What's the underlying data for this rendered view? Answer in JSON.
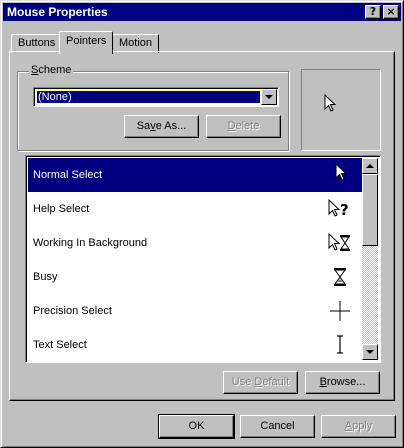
{
  "window": {
    "title": "Mouse Properties",
    "help_glyph": "?",
    "close_glyph": "×"
  },
  "tabs": [
    {
      "label": "Buttons",
      "active": false
    },
    {
      "label": "Pointers",
      "active": true
    },
    {
      "label": "Motion",
      "active": false
    }
  ],
  "scheme": {
    "group_label_first": "S",
    "group_label_rest": "cheme",
    "selected_value": "(None)",
    "save_as_label_pre": "Sa",
    "save_as_label_mn": "v",
    "save_as_label_post": "e As...",
    "delete_label_pre": "",
    "delete_label_mn": "D",
    "delete_label_post": "elete"
  },
  "pointers": [
    {
      "label": "Normal Select",
      "icon": "arrow-cursor-icon",
      "selected": true
    },
    {
      "label": "Help Select",
      "icon": "help-cursor-icon",
      "selected": false
    },
    {
      "label": "Working In Background",
      "icon": "working-cursor-icon",
      "selected": false
    },
    {
      "label": "Busy",
      "icon": "hourglass-icon",
      "selected": false
    },
    {
      "label": "Precision Select",
      "icon": "crosshair-icon",
      "selected": false
    },
    {
      "label": "Text Select",
      "icon": "ibeam-icon",
      "selected": false
    }
  ],
  "list_buttons": {
    "use_default_pre": "Use ",
    "use_default_mn": "D",
    "use_default_post": "efault",
    "browse_pre": "",
    "browse_mn": "B",
    "browse_post": "rowse..."
  },
  "dialog_buttons": {
    "ok": "OK",
    "cancel": "Cancel",
    "apply_pre": "",
    "apply_mn": "A",
    "apply_post": "pply"
  },
  "colors": {
    "titlebar": "#000080",
    "face": "#c0c0c0",
    "selection": "#000080"
  }
}
